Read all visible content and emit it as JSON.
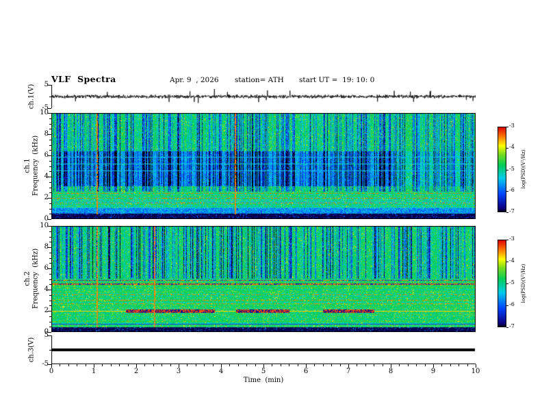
{
  "header": {
    "title": "VLF  Spectra",
    "date": "Apr. 9  , 2026",
    "station": "station= ATH",
    "start_ut": "start UT =  19: 10: 0"
  },
  "x_axis": {
    "label": "Time  (min)",
    "range": [
      0,
      10
    ],
    "major_ticks": [
      0,
      1,
      2,
      3,
      4,
      5,
      6,
      7,
      8,
      9,
      10
    ],
    "minor_tick_step": 0.2
  },
  "colorbar": {
    "label": "log(PSD)(V²/Hz)",
    "ticks": [
      -3,
      -4,
      -5,
      -6,
      -7
    ],
    "range_low": -7,
    "range_high": -3,
    "colormap": "black-blue-cyan-green-yellow-red (jet-like)"
  },
  "chart_data": [
    {
      "type": "line",
      "name": "ch1 waveform",
      "ylabel": "ch.1(V)",
      "ylim": [
        -5,
        5
      ],
      "yticks": [
        5,
        -5
      ],
      "x_range_min": [
        0,
        10
      ],
      "series_description": "broadband audio-band noise around 0 V, typical amplitude about ±1 V with impulsive spikes to about ±3 V throughout the 10 min record"
    },
    {
      "type": "heatmap",
      "name": "ch1 spectrogram",
      "channel": "ch.1",
      "ylabel": "Frequency  (kHz)",
      "ylim": [
        0,
        10
      ],
      "yticks": [
        0,
        2,
        4,
        6,
        8,
        10
      ],
      "x_range_min": [
        0,
        10
      ],
      "value_label": "log(PSD)(V²/Hz)",
      "value_range": [
        -7,
        -3
      ],
      "features": [
        "green background near -5 with cyan and yellow speckle",
        "dense vertical blue striations (PSD near -6.5) between 3 and 10 kHz",
        "persistent dark-blue depression 3-6.5 kHz from about 0.3 to 8 min",
        "thin light horizontal lines near 4.6, 5.2 and 5.9 kHz",
        "red dotted horizontal interference lines near 1.5, 2.0 and 2.5 kHz",
        "dark band 0.6-1.0 kHz and black band below about 0.5 kHz",
        "red vertical transient lines near 1.1 and 4.3 min"
      ]
    },
    {
      "type": "heatmap",
      "name": "ch2 spectrogram",
      "channel": "ch.2",
      "ylabel": "Frequency  (kHz)",
      "ylim": [
        0,
        10
      ],
      "yticks": [
        0,
        2,
        4,
        6,
        8,
        10
      ],
      "x_range_min": [
        0,
        10
      ],
      "value_label": "log(PSD)(V²/Hz)",
      "value_range": [
        -7,
        -3
      ],
      "features": [
        "green background with dense vertical blue striations above about 5 kHz",
        "dark red/black horizontal lines near 4.55 and 4.9 kHz",
        "red dotted horizontal lines near 2.7, 3.05 and 3.55 kHz",
        "strong intermittent dark-red band at 2.0 kHz (about 1.8-3.9, 4.4-5.6 and 6.4-7.6 min)",
        "horizontal striations below 2 kHz, black band below about 0.5 kHz",
        "red vertical transient lines near 1.1 and 2.4 min"
      ]
    },
    {
      "type": "line",
      "name": "ch3 waveform",
      "ylabel": "ch.3(V)",
      "ylim": [
        -5,
        5
      ],
      "yticks": [
        5,
        -5
      ],
      "x_range_min": [
        0,
        10
      ],
      "series_description": "flat thick line at 0 V for the whole record (channel inactive)"
    }
  ]
}
